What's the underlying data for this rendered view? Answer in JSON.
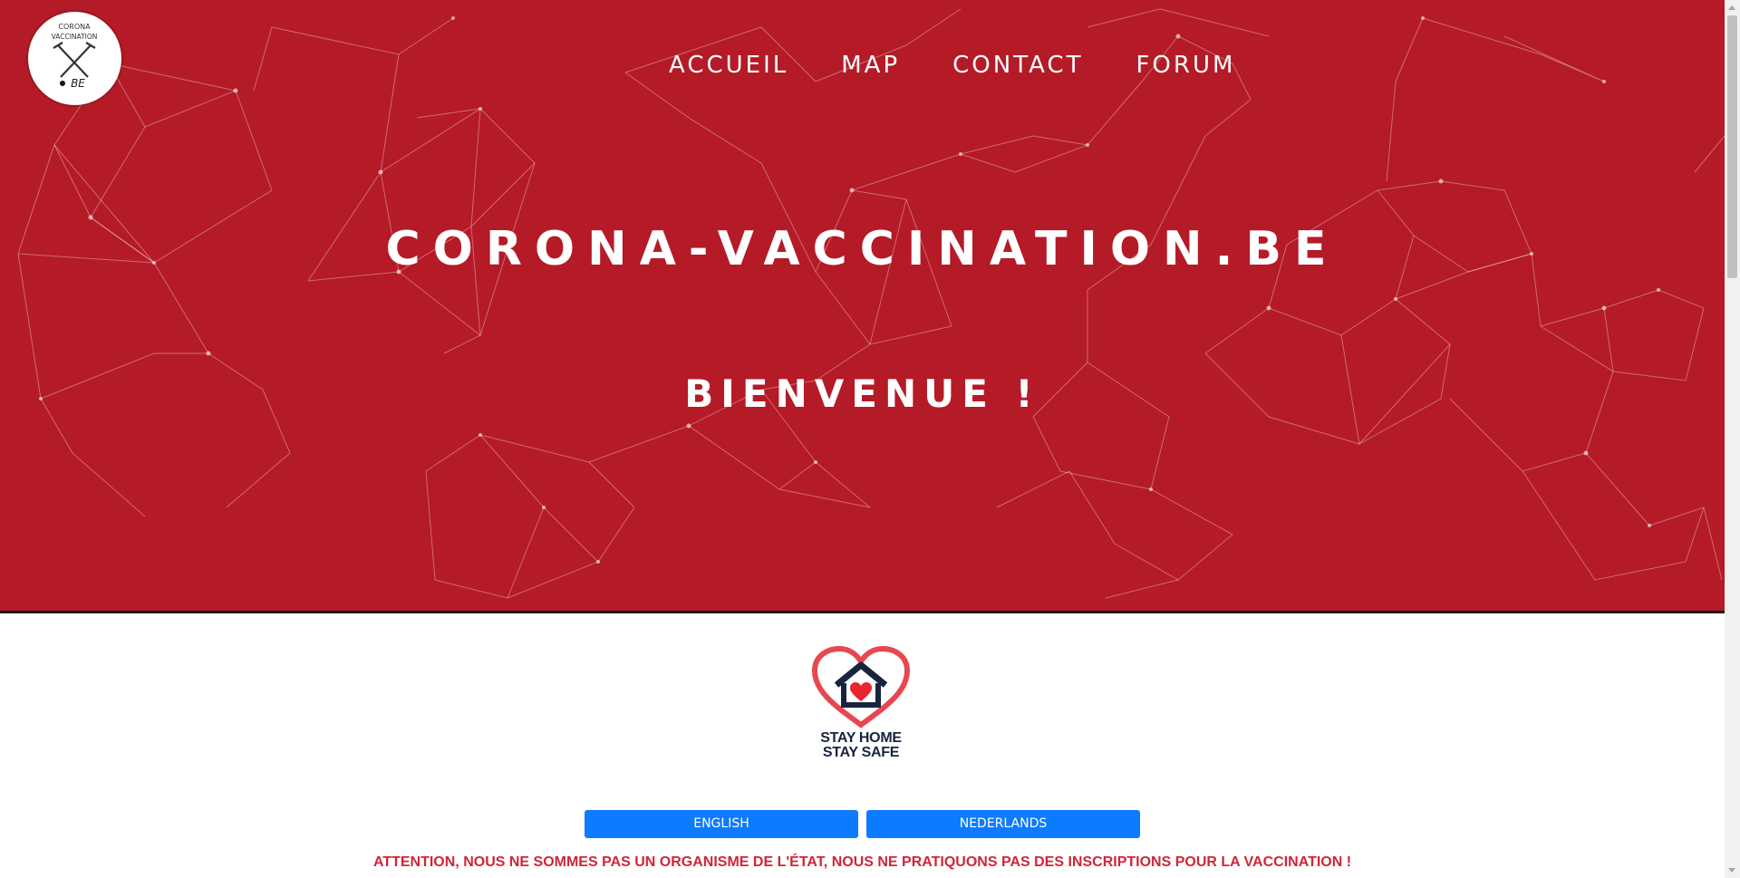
{
  "logo": {
    "text_top": "CORONA",
    "text_mid": "VACCINATION",
    "text_suffix": "BE"
  },
  "nav": {
    "items": [
      {
        "label": "ACCUEIL"
      },
      {
        "label": "MAP"
      },
      {
        "label": "CONTACT"
      },
      {
        "label": "FORUM"
      }
    ]
  },
  "hero": {
    "title": "CORONA-VACCINATION.BE",
    "welcome": "BIENVENUE !"
  },
  "stay_home": {
    "line1": "STAY HOME",
    "line2": "STAY SAFE"
  },
  "languages": {
    "english": "ENGLISH",
    "dutch": "NEDERLANDS"
  },
  "notice": "ATTENTION, NOUS NE SOMMES PAS UN ORGANISME DE L'ÉTAT, NOUS NE PRATIQUONS PAS DES INSCRIPTIONS POUR LA VACCINATION !",
  "colors": {
    "hero_background": "#b51a27",
    "button_blue": "#0d7bff",
    "notice_red": "#d0253a"
  }
}
